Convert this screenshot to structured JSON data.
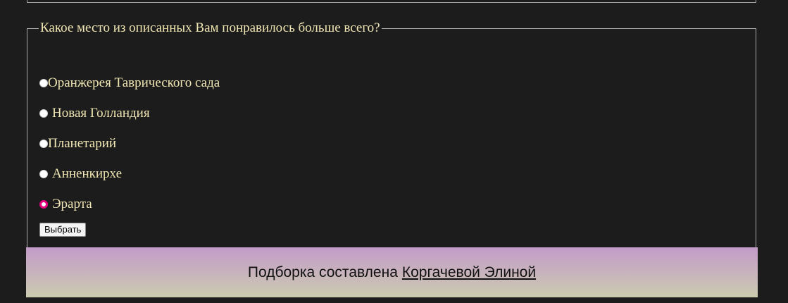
{
  "poll": {
    "question": "Какое место из описанных Вам понравилось больше всего?",
    "options": [
      {
        "label": "Оранжерея Таврического сада",
        "checked": false
      },
      {
        "label": "Новая Голландия",
        "checked": false
      },
      {
        "label": "Планетарий",
        "checked": false
      },
      {
        "label": "Анненкирхе",
        "checked": false
      },
      {
        "label": "Эрарта",
        "checked": true
      }
    ],
    "submit_label": "Выбрать"
  },
  "footer": {
    "text": "Подборка составлена",
    "author_link": "Коргачевой Элиной"
  },
  "colors": {
    "background": "#1c1c1c",
    "text": "#f0e6b3",
    "radio_checked": "#e3007d",
    "footer_gradient_top": "#c39bc9",
    "footer_gradient_bottom": "#cccbb0"
  }
}
